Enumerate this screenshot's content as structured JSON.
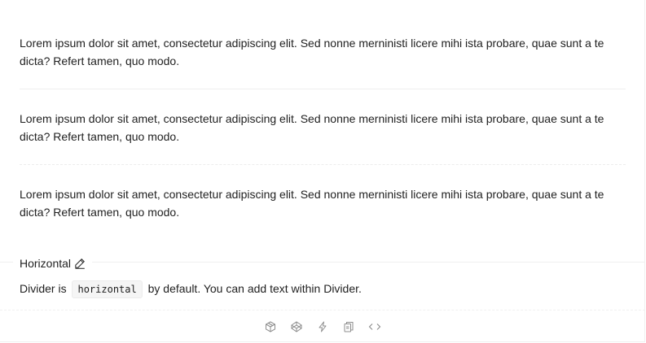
{
  "paragraphs": [
    "Lorem ipsum dolor sit amet, consectetur adipiscing elit. Sed nonne merninisti licere mihi ista probare, quae sunt a te dicta? Refert tamen, quo modo.",
    "Lorem ipsum dolor sit amet, consectetur adipiscing elit. Sed nonne merninisti licere mihi ista probare, quae sunt a te dicta? Refert tamen, quo modo.",
    "Lorem ipsum dolor sit amet, consectetur adipiscing elit. Sed nonne merninisti licere mihi ista probare, quae sunt a te dicta? Refert tamen, quo modo."
  ],
  "demo": {
    "title": "Horizontal",
    "description_prefix": "Divider is",
    "description_code": "horizontal",
    "description_suffix": "by default. You can add text within Divider."
  },
  "icons": {
    "edit": "edit-icon",
    "actions": [
      "codesandbox-icon",
      "codepen-icon",
      "thunderbolt-icon",
      "copy-icon",
      "code-expand-icon"
    ]
  },
  "colors": {
    "text": "#1f1f1f",
    "divider": "#efefef",
    "icon": "#8c8c8c"
  }
}
